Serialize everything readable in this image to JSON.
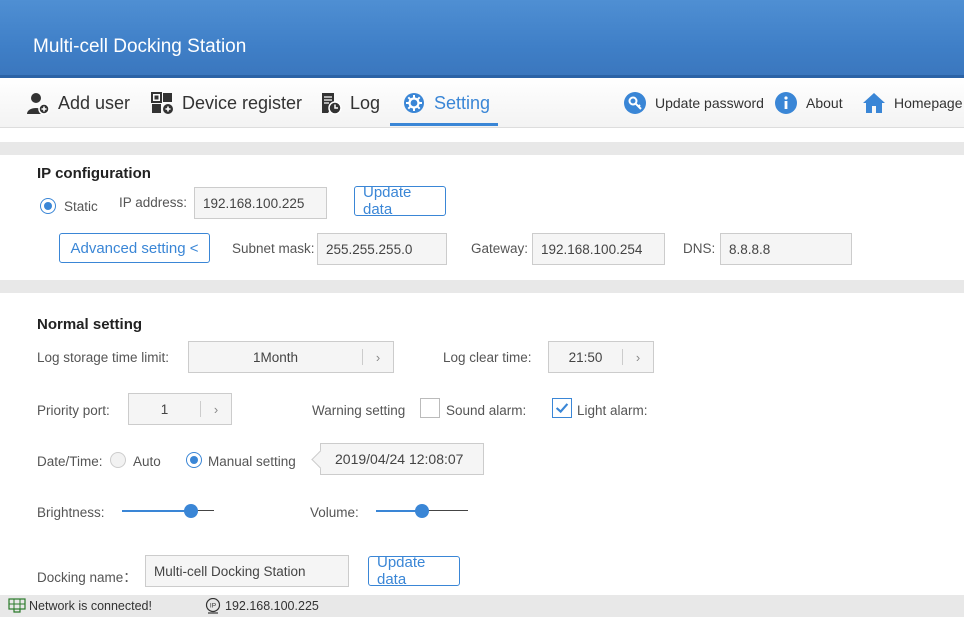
{
  "app": {
    "title": "Multi-cell Docking Station"
  },
  "nav": {
    "add_user": "Add user",
    "device_register": "Device register",
    "log": "Log",
    "setting": "Setting",
    "update_password": "Update password",
    "about": "About",
    "homepage": "Homepage"
  },
  "ip_config": {
    "title": "IP configuration",
    "static_label": "Static",
    "ip_label": "IP address:",
    "ip_value": "192.168.100.225",
    "update_button": "Update data",
    "advanced_button": "Advanced setting <",
    "subnet_label": "Subnet mask:",
    "subnet_value": "255.255.255.0",
    "gateway_label": "Gateway:",
    "gateway_value": "192.168.100.254",
    "dns_label": "DNS:",
    "dns_value": "8.8.8.8"
  },
  "normal": {
    "title": "Normal setting",
    "log_storage_label": "Log storage time limit:",
    "log_storage_value": "1Month",
    "log_clear_label": "Log clear time:",
    "log_clear_value": "21:50",
    "priority_label": "Priority port:",
    "priority_value": "1",
    "warning_label": "Warning setting",
    "sound_alarm_label": "Sound alarm:",
    "sound_alarm_checked": false,
    "light_alarm_label": "Light alarm:",
    "light_alarm_checked": true,
    "datetime_label": "Date/Time:",
    "auto_label": "Auto",
    "manual_label": "Manual setting",
    "datetime_value": "2019/04/24 12:08:07",
    "brightness_label": "Brightness:",
    "brightness_level": 0.75,
    "volume_label": "Volume:",
    "volume_level": 0.5,
    "docking_name_label": "Docking name：",
    "docking_name_value": "Multi-cell Docking Station",
    "update_button": "Update data"
  },
  "status": {
    "network": "Network is connected!",
    "ip": "192.168.100.225"
  },
  "colors": {
    "accent": "#3a86d6",
    "titlebar": "#4a89cf"
  }
}
